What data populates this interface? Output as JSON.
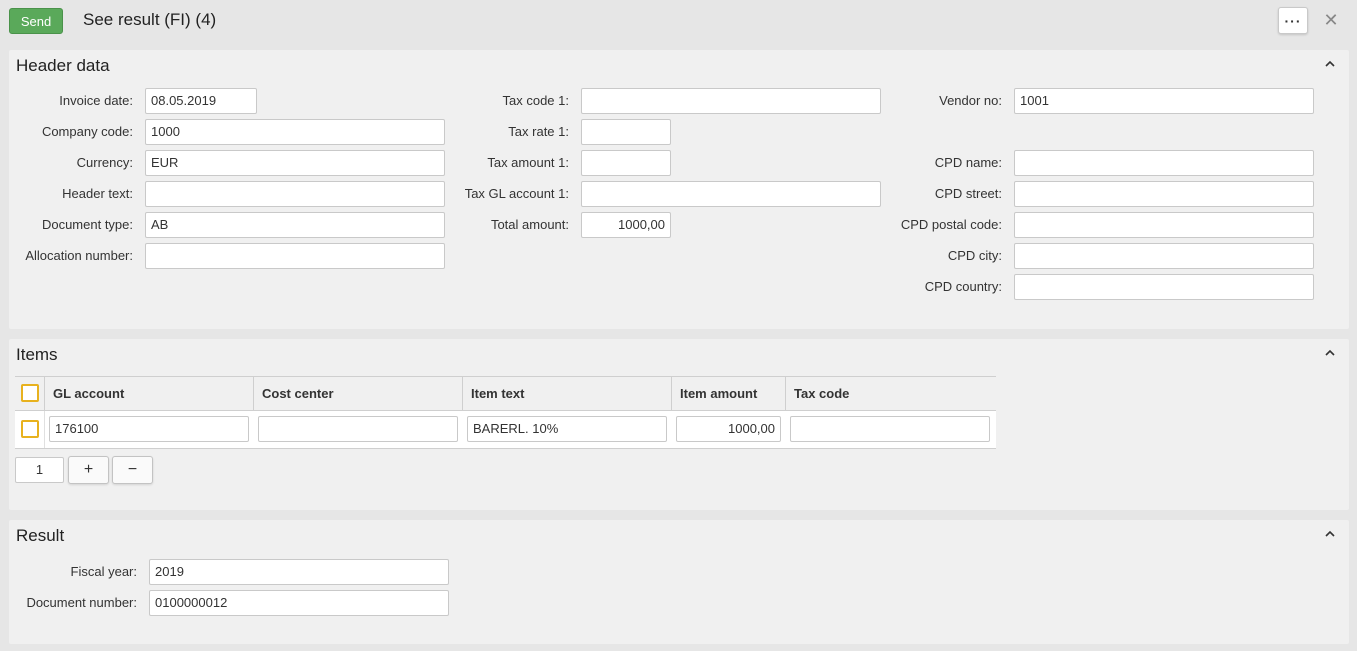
{
  "toolbar": {
    "send_label": "Send",
    "title": "See result (FI) (4)",
    "more_label": "···",
    "close_label": "✕"
  },
  "header_panel": {
    "title": "Header data",
    "col1": [
      {
        "label": "Invoice date:",
        "value": "08.05.2019"
      },
      {
        "label": "Company code:",
        "value": "1000"
      },
      {
        "label": "Currency:",
        "value": "EUR"
      },
      {
        "label": "Header text:",
        "value": ""
      },
      {
        "label": "Document type:",
        "value": "AB"
      },
      {
        "label": "Allocation number:",
        "value": ""
      }
    ],
    "col2": [
      {
        "label": "Tax code 1:",
        "value": ""
      },
      {
        "label": "Tax rate 1:",
        "value": ""
      },
      {
        "label": "Tax amount 1:",
        "value": ""
      },
      {
        "label": "Tax GL account 1:",
        "value": ""
      },
      {
        "label": "Total amount:",
        "value": "1000,00"
      }
    ],
    "col3": [
      {
        "label": "Vendor no:",
        "value": "1001"
      },
      {
        "label": "CPD name:",
        "value": ""
      },
      {
        "label": "CPD street:",
        "value": ""
      },
      {
        "label": "CPD postal code:",
        "value": ""
      },
      {
        "label": "CPD city:",
        "value": ""
      },
      {
        "label": "CPD country:",
        "value": ""
      }
    ]
  },
  "items_panel": {
    "title": "Items",
    "columns": [
      "GL account",
      "Cost center",
      "Item text",
      "Item amount",
      "Tax code"
    ],
    "rows": [
      {
        "gl_account": "176100",
        "cost_center": "",
        "item_text": "BARERL. 10%",
        "item_amount": "1000,00",
        "tax_code": ""
      }
    ],
    "row_count": "1",
    "add_label": "+",
    "remove_label": "−"
  },
  "result_panel": {
    "title": "Result",
    "fields": [
      {
        "label": "Fiscal year:",
        "value": "2019"
      },
      {
        "label": "Document number:",
        "value": "0100000012"
      }
    ]
  },
  "colors": {
    "send_green": "#5aa95a",
    "checkbox_orange": "#e8b21e"
  }
}
